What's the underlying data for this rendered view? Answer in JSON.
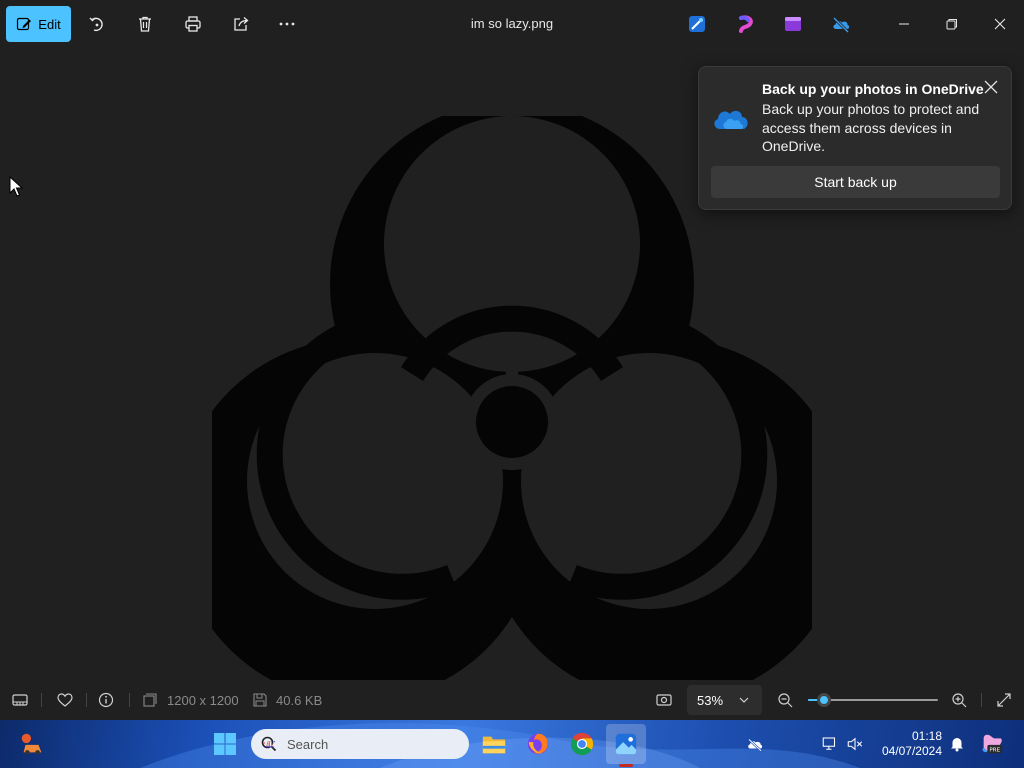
{
  "toolbar": {
    "edit_label": "Edit",
    "file_title": "im so lazy.png"
  },
  "notification": {
    "title": "Back up your photos in OneDrive",
    "body": "Back up your photos to protect and access them across devices in OneDrive.",
    "button_label": "Start back up"
  },
  "statusbar": {
    "dimensions": "1200 x 1200",
    "file_size": "40.6 KB",
    "zoom_level": "53%",
    "zoom_slider_fraction": 0.12
  },
  "taskbar": {
    "search_placeholder": "Search",
    "time": "01:18",
    "date": "04/07/2024"
  },
  "colors": {
    "accent": "#4cc2ff",
    "background": "#202020",
    "toast_bg": "#2b2b2b"
  }
}
